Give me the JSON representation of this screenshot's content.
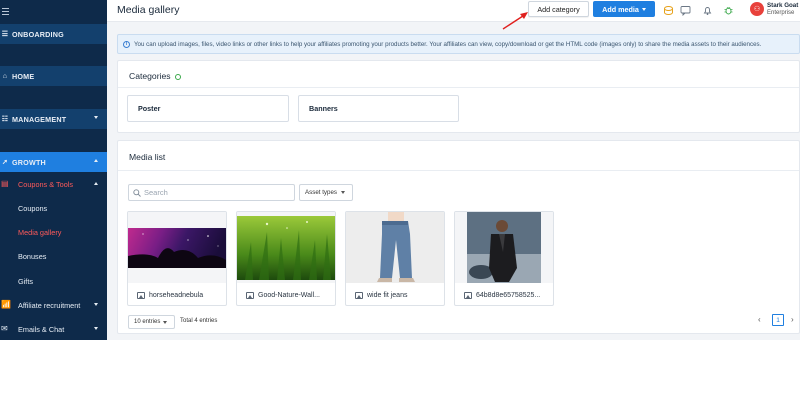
{
  "sidebar": {
    "onboarding": "ONBOARDING",
    "home": "HOME",
    "management": "MANAGEMENT",
    "growth": "GROWTH",
    "coupons_tools": "Coupons & Tools",
    "items": [
      {
        "label": "Coupons"
      },
      {
        "label": "Media gallery"
      },
      {
        "label": "Bonuses"
      },
      {
        "label": "Gifts"
      }
    ],
    "affiliate_recruitment": "Affiliate recruitment",
    "emails_chat": "Emails & Chat"
  },
  "header": {
    "title": "Media gallery",
    "add_category": "Add category",
    "add_media": "Add media",
    "user_name": "Stark Goat",
    "user_plan": "Enterprise"
  },
  "info": {
    "text": "You can upload images, files, video links or other links to help your affiliates promoting your products better. Your affiliates can view, copy/download or get the HTML code (images only) to share the media assets to their audiences."
  },
  "categories": {
    "title": "Categories",
    "items": [
      "Poster",
      "Banners"
    ]
  },
  "media_list": {
    "title": "Media list",
    "search_placeholder": "Search",
    "asset_types": "Asset types",
    "items": [
      {
        "name": "horseheadnebula"
      },
      {
        "name": "Good-Nature-Wall..."
      },
      {
        "name": "wide fit jeans"
      },
      {
        "name": "64b8d8e65758525..."
      }
    ],
    "entries": "10 entries",
    "total": "Total 4 entries",
    "page": "1"
  },
  "colors": {
    "sidebar": "#0e2a4a",
    "accent": "#1f7fe0",
    "active_item": "#ff5a5a",
    "annotation_arrow": "#e0201e"
  }
}
